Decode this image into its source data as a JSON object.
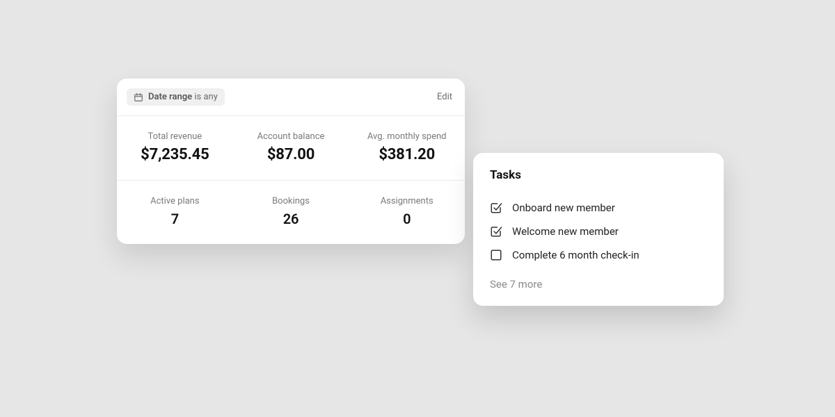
{
  "metrics_card": {
    "filter": {
      "label_prefix": "Date range",
      "label_suffix": "is any"
    },
    "edit_label": "Edit",
    "row1": [
      {
        "label": "Total revenue",
        "value": "$7,235.45"
      },
      {
        "label": "Account balance",
        "value": "$87.00"
      },
      {
        "label": "Avg. monthly spend",
        "value": "$381.20"
      }
    ],
    "row2": [
      {
        "label": "Active plans",
        "value": "7"
      },
      {
        "label": "Bookings",
        "value": "26"
      },
      {
        "label": "Assignments",
        "value": "0"
      }
    ]
  },
  "tasks_card": {
    "title": "Tasks",
    "items": [
      {
        "label": "Onboard new member",
        "done": true
      },
      {
        "label": "Welcome new member",
        "done": true
      },
      {
        "label": "Complete 6 month check-in",
        "done": false
      }
    ],
    "see_more": "See 7 more"
  }
}
